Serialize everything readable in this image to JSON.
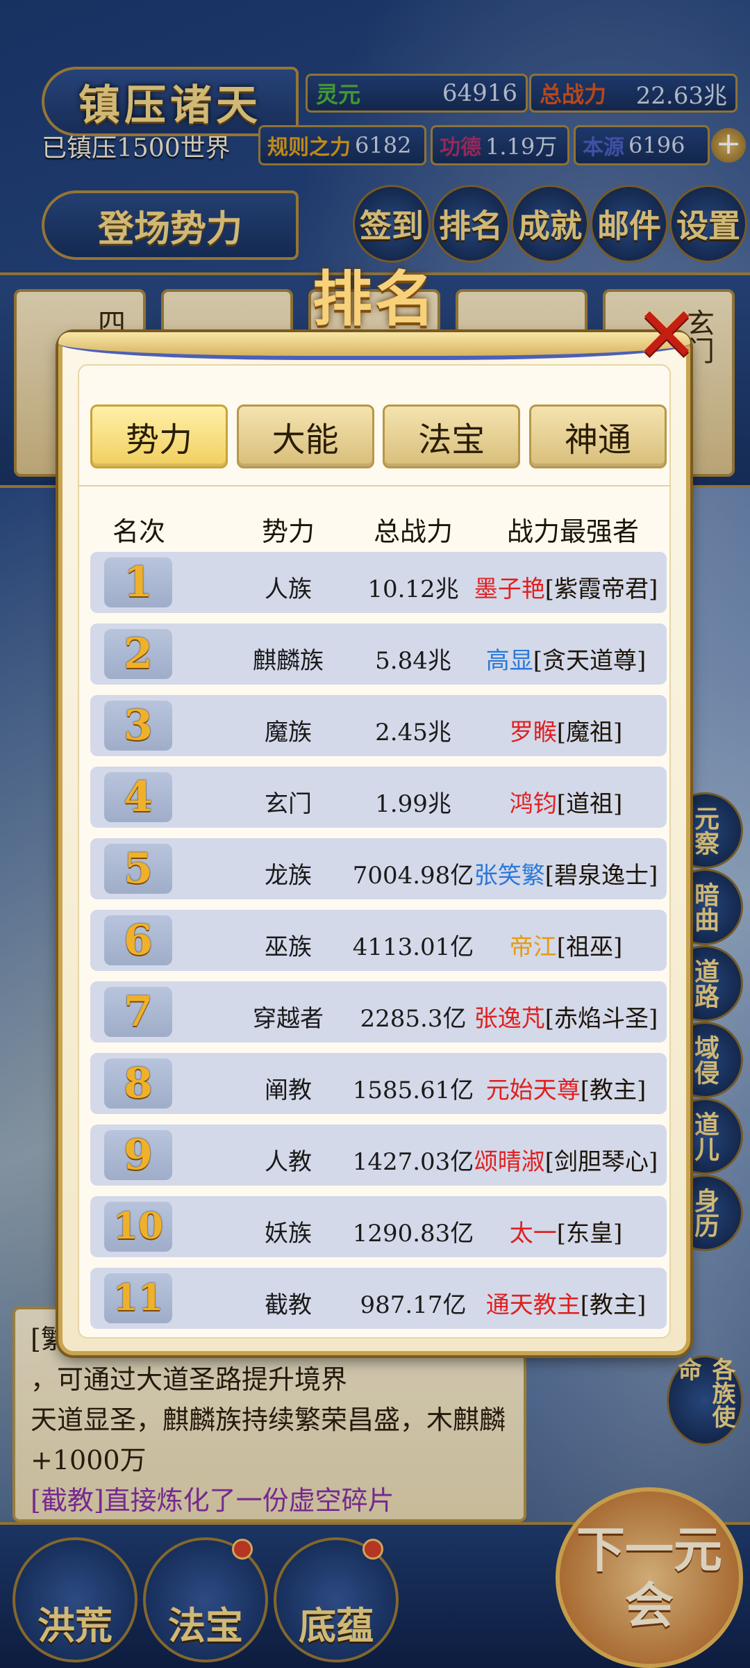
{
  "header": {
    "game_title": "镇压诸天",
    "suppressed": "已镇压1500世界",
    "resources": [
      {
        "label": "灵元",
        "value": "64916",
        "color": "#4fb33a"
      },
      {
        "label": "总战力",
        "value": "22.63兆",
        "color": "#d9541e"
      }
    ],
    "small_resources": [
      {
        "label": "规则之力",
        "value": "6182",
        "color": "#e0a21f"
      },
      {
        "label": "功德",
        "value": "1.19万",
        "color": "#b0306a"
      },
      {
        "label": "本源",
        "value": "6196",
        "color": "#4a5fc2"
      }
    ],
    "plus_label": "+",
    "stage_button": "登场势力",
    "nav": [
      {
        "label": "签到"
      },
      {
        "label": "排名"
      },
      {
        "label": "成就"
      },
      {
        "label": "邮件"
      },
      {
        "label": "设置"
      }
    ]
  },
  "faction_strip": {
    "cards": [
      "四海汪洋",
      "",
      "",
      "",
      "玄门"
    ]
  },
  "side_buttons": [
    "元察",
    "暗曲",
    "道路",
    "域侵",
    "道儿",
    "身历",
    "各族使命"
  ],
  "log": {
    "lines": [
      {
        "text": "[繁]",
        "purple": false
      },
      {
        "text": "，可通过大道圣路提升境界",
        "purple": false
      },
      {
        "text": "天道显圣，麒麟族持续繁荣昌盛，木麒麟+1000万",
        "purple": false
      },
      {
        "text": "[截教]直接炼化了一份虚空碎片",
        "purple": true
      }
    ]
  },
  "bottom": {
    "buttons": [
      "洪荒",
      "法宝",
      "底蕴"
    ],
    "next": "下一元会"
  },
  "modal": {
    "title": "排名",
    "close": "✕",
    "tabs": [
      {
        "label": "势力",
        "active": true
      },
      {
        "label": "大能",
        "active": false
      },
      {
        "label": "法宝",
        "active": false
      },
      {
        "label": "神通",
        "active": false
      }
    ],
    "columns": [
      "名次",
      "势力",
      "总战力",
      "战力最强者"
    ],
    "rows": [
      {
        "rank": "1",
        "faction": "人族",
        "power": "10.12兆",
        "leader": "墨子艳",
        "leader_color": "#e02020",
        "title": "[紫霞帝君]"
      },
      {
        "rank": "2",
        "faction": "麒麟族",
        "power": "5.84兆",
        "leader": "高显",
        "leader_color": "#2a78d8",
        "title": "[贪天道尊]"
      },
      {
        "rank": "3",
        "faction": "魔族",
        "power": "2.45兆",
        "leader": "罗睺",
        "leader_color": "#e02020",
        "title": "[魔祖]"
      },
      {
        "rank": "4",
        "faction": "玄门",
        "power": "1.99兆",
        "leader": "鸿钧",
        "leader_color": "#e02020",
        "title": "[道祖]"
      },
      {
        "rank": "5",
        "faction": "龙族",
        "power": "7004.98亿",
        "leader": "张笑繁",
        "leader_color": "#2a78d8",
        "title": "[碧泉逸士]"
      },
      {
        "rank": "6",
        "faction": "巫族",
        "power": "4113.01亿",
        "leader": "帝江",
        "leader_color": "#e59a14",
        "title": "[祖巫]"
      },
      {
        "rank": "7",
        "faction": "穿越者",
        "power": "2285.3亿",
        "leader": "张逸芃",
        "leader_color": "#e02020",
        "title": "[赤焰斗圣]"
      },
      {
        "rank": "8",
        "faction": "阐教",
        "power": "1585.61亿",
        "leader": "元始天尊",
        "leader_color": "#e02020",
        "title": "[教主]"
      },
      {
        "rank": "9",
        "faction": "人教",
        "power": "1427.03亿",
        "leader": "颂晴淑",
        "leader_color": "#e02020",
        "title": "[剑胆琴心]"
      },
      {
        "rank": "10",
        "faction": "妖族",
        "power": "1290.83亿",
        "leader": "太一",
        "leader_color": "#e02020",
        "title": "[东皇]"
      },
      {
        "rank": "11",
        "faction": "截教",
        "power": "987.17亿",
        "leader": "通天教主",
        "leader_color": "#e02020",
        "title": "[教主]"
      }
    ]
  }
}
